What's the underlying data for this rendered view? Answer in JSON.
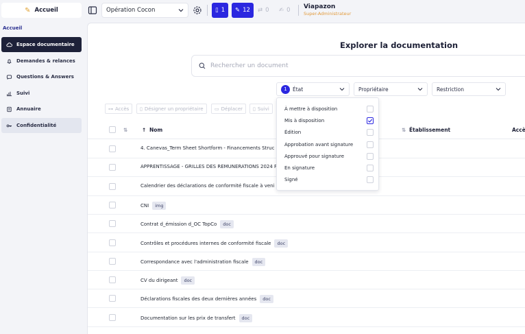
{
  "topbar": {
    "home_label": "Accueil",
    "project": "Opération Cocon",
    "pills": [
      "1",
      "12",
      "0",
      "0"
    ],
    "user_name": "Viapazon",
    "user_role": "Super-Administrateur"
  },
  "sidebar": {
    "title": "Accueil",
    "items": [
      {
        "label": "Espace documentaire",
        "icon": "cloud-icon"
      },
      {
        "label": "Demandes & relances",
        "icon": "bell-icon"
      },
      {
        "label": "Questions & Answers",
        "icon": "chat-icon"
      },
      {
        "label": "Suivi",
        "icon": "chart-icon"
      },
      {
        "label": "Annuaire",
        "icon": "book-icon"
      },
      {
        "label": "Confidentialité",
        "icon": "key-icon"
      }
    ]
  },
  "main": {
    "title": "Explorer la documentation",
    "search_placeholder": "Rechercher un document",
    "filters": {
      "etat_badge": "1",
      "etat": "État",
      "proprietaire": "Propriétaire",
      "restriction": "Restriction"
    },
    "actions": [
      "Accès",
      "Désigner un propriétaire",
      "Déplacer",
      "Suivi"
    ],
    "columns": {
      "name": "Nom",
      "etablissement": "Établissement",
      "acces": "Accè"
    },
    "rows": [
      {
        "name": "4. Canevas_Term Sheet Shortform - Financements Struc",
        "tag": ""
      },
      {
        "name": "APPRENTISSAGE - GRILLES DES REMUNERATIONS 2024 PAR E",
        "tag": ""
      },
      {
        "name": "Calendrier des déclarations de conformité fiscale à veni",
        "tag": ""
      },
      {
        "name": "CNI",
        "tag": "img"
      },
      {
        "name": "Contrat d_émission d_OC TopCo",
        "tag": "doc"
      },
      {
        "name": "Contrôles et procédures internes de conformité fiscale",
        "tag": "doc"
      },
      {
        "name": "Correspondance avec l'administration fiscale",
        "tag": "doc"
      },
      {
        "name": "CV du dirigeant",
        "tag": "doc"
      },
      {
        "name": "Déclarations fiscales des deux dernières années",
        "tag": "doc"
      },
      {
        "name": "Documentation sur les prix de transfert",
        "tag": "doc"
      }
    ]
  },
  "dropdown": {
    "options": [
      {
        "label": "À mettre à disposition",
        "checked": false
      },
      {
        "label": "Mis à disposition",
        "checked": true
      },
      {
        "label": "Édition",
        "checked": false
      },
      {
        "label": "Approbation avant signature",
        "checked": false
      },
      {
        "label": "Approuvé pour signature",
        "checked": false
      },
      {
        "label": "En signature",
        "checked": false
      },
      {
        "label": "Signé",
        "checked": false
      }
    ]
  },
  "colors": {
    "accent": "#2b27e0",
    "sidebar_active": "#1d2139",
    "role": "#e29a3a"
  }
}
